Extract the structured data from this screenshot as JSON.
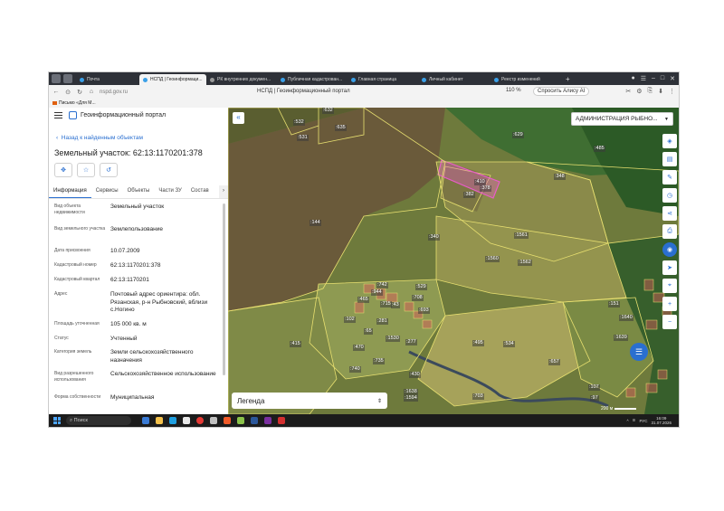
{
  "browser": {
    "tabs": [
      {
        "label": "Почта",
        "active": false
      },
      {
        "label": "НСПД | Геоинформаци...",
        "active": true
      },
      {
        "label": "РК внутренних докумен...",
        "active": false
      },
      {
        "label": "Публичная кадастрован...",
        "active": false
      },
      {
        "label": "Главная страница",
        "active": false
      },
      {
        "label": "Личный кабинет",
        "active": false
      },
      {
        "label": "Реестр изменений",
        "active": false
      }
    ],
    "url": "nspd.gov.ru",
    "page_title": "НСПД | Геоинформационный портал",
    "zoom": "110 %",
    "alice_label": "Спросить Алису AI",
    "bookmark": "Письмо «Для М..."
  },
  "panel": {
    "app_title": "Геоинформационный портал",
    "back_link": "Назад к найденным объектам",
    "title": "Земельный участок: 62:13:1170201:378",
    "tabs": [
      "Информация",
      "Сервисы",
      "Объекты",
      "Части ЗУ",
      "Состав"
    ],
    "attributes": [
      {
        "name": "Вид объекта недвижимости",
        "value": "Земельный участок"
      },
      {
        "name": "Вид земельного участка",
        "value": "Землепользование"
      },
      {
        "name": "Дата присвоения",
        "value": "10.07.2009"
      },
      {
        "name": "Кадастровый номер",
        "value": "62:13:1170201:378"
      },
      {
        "name": "Кадастровый квартал",
        "value": "62:13:1170201"
      },
      {
        "name": "Адрес",
        "value": "Почтовый адрес ориентира: обл. Рязанская, р-н Рыбновский, вблизи с.Ногино"
      },
      {
        "name": "Площадь уточненная",
        "value": "105 000 кв. м"
      },
      {
        "name": "Статус",
        "value": "Учтенный"
      },
      {
        "name": "Категория земель",
        "value": "Земли сельскохозяйственного назначения"
      },
      {
        "name": "Вид разрешенного использования",
        "value": "Сельскохозяйственное использование"
      },
      {
        "name": "Форма собственности",
        "value": "Муниципальная"
      }
    ]
  },
  "map": {
    "admin_select": "АДМИНИСТРАЦИЯ РЫБНО...",
    "legend_label": "Легенда",
    "scale_label": "200 м",
    "parcel_labels": [
      ":632",
      ":532",
      ":635",
      ":531",
      ":629",
      ":485",
      ":348",
      ":410",
      ":378",
      ":382",
      ":144",
      ":340",
      ":1561",
      ":1560",
      ":1562",
      ":742",
      ":944",
      ":529",
      ":465",
      ":708",
      ":715",
      ":693",
      ":43",
      ":281",
      ":102",
      ":65",
      ":1530",
      ":277",
      ":415",
      ":470",
      ":430",
      ":495",
      ":534",
      ":735",
      ":740",
      ":657",
      ":1639",
      ":1640",
      ":151",
      ":703",
      ":1638",
      ":1594",
      ":107",
      ":97"
    ],
    "highlight_color": "#e85cc8"
  },
  "taskbar": {
    "search_placeholder": "Поиск",
    "lang": "РУС",
    "time": "16:09",
    "date": "31.07.2026"
  }
}
